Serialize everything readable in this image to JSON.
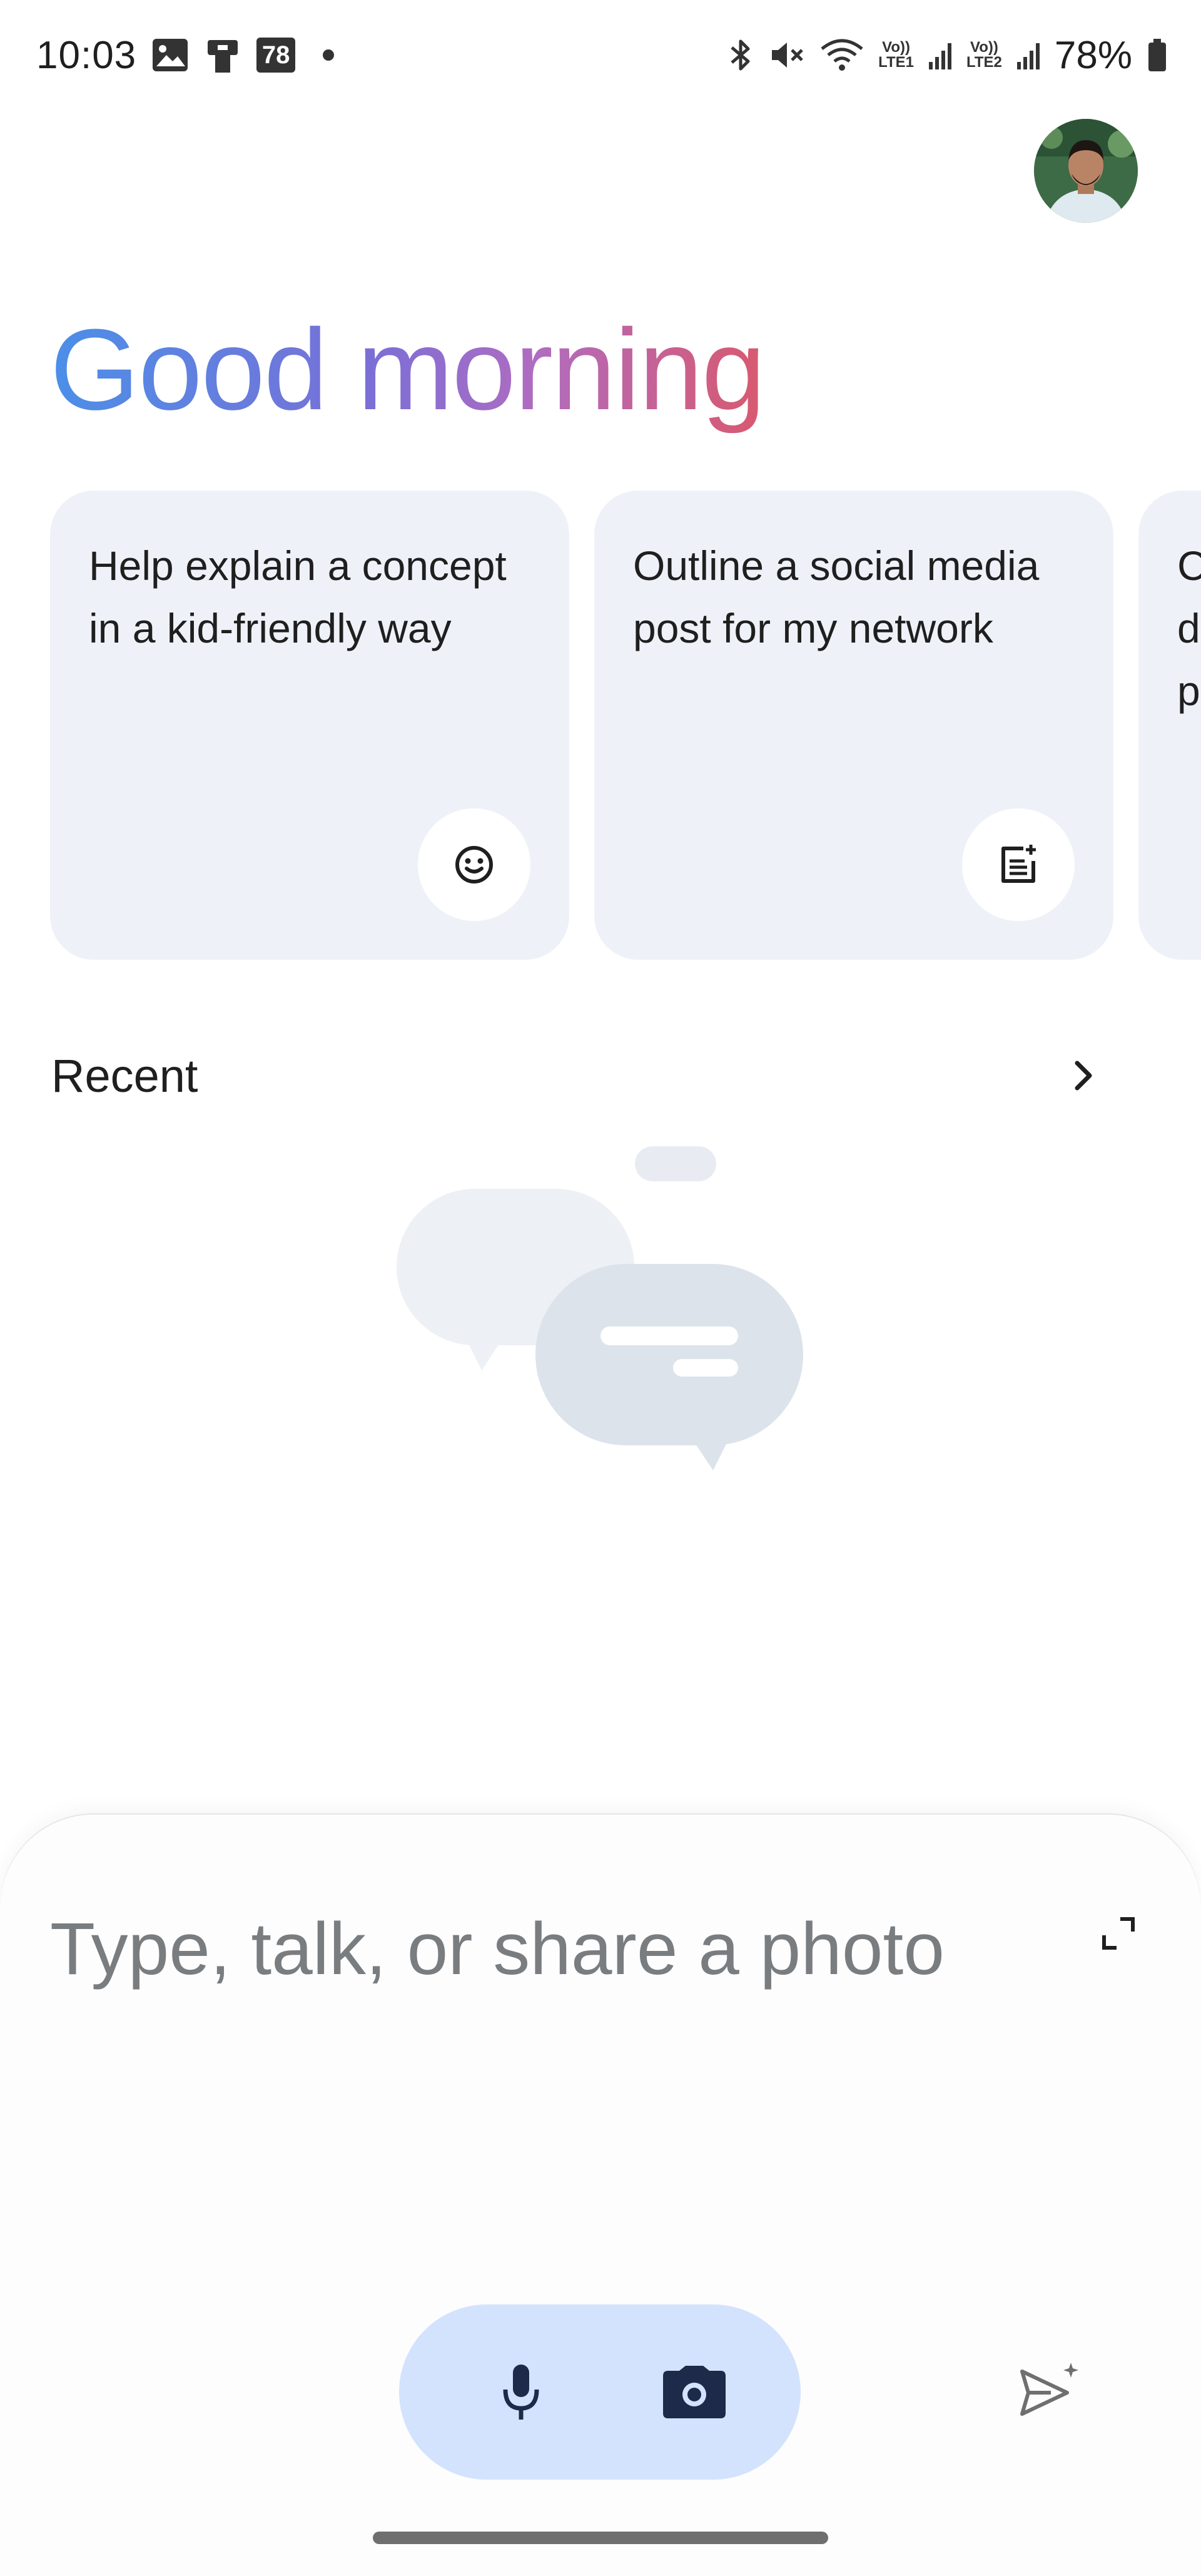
{
  "status_bar": {
    "time": "10:03",
    "notification_badge": "78",
    "lte1_label": "Vo))\nLTE1",
    "lte2_label": "Vo))\nLTE2",
    "battery_percent": "78%"
  },
  "greeting": "Good morning",
  "suggestions": [
    {
      "text": "Help explain a concept in a kid-friendly way",
      "icon": "smiley-face-icon"
    },
    {
      "text": "Outline a social media post for my network",
      "icon": "note-add-icon"
    },
    {
      "text": "C d p",
      "icon": ""
    }
  ],
  "recent": {
    "title": "Recent"
  },
  "input": {
    "placeholder": "Type, talk, or share a photo"
  },
  "colors": {
    "greeting_gradient": [
      "#4b8fe8",
      "#7b6fd6",
      "#b06cc0",
      "#d9596e"
    ],
    "card_background": "#eef2f8",
    "media_pill": "#d3e3fd",
    "icon_dark": "#1e2a4a"
  }
}
